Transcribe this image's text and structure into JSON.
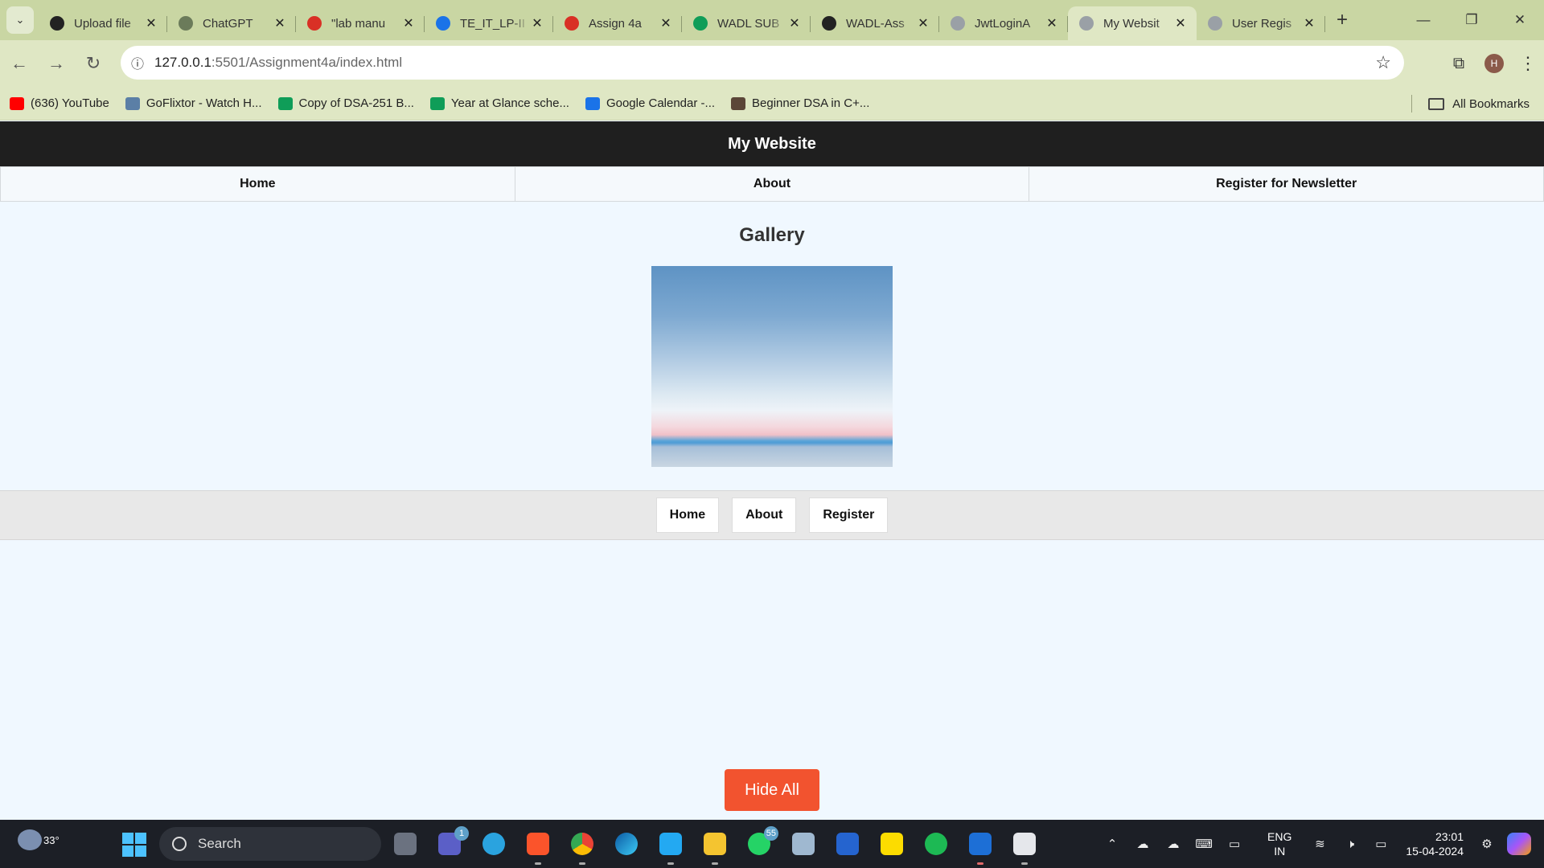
{
  "browser": {
    "tabs": [
      {
        "title": "Upload file",
        "favicon": "github-icon",
        "color": "#222222"
      },
      {
        "title": "ChatGPT",
        "favicon": "chatgpt-icon",
        "color": "#6b7b5a"
      },
      {
        "title": "\"lab manu",
        "favicon": "gmail-icon",
        "color": "#d93025"
      },
      {
        "title": "TE_IT_LP-II",
        "favicon": "drive-icon",
        "color": "#1a73e8"
      },
      {
        "title": "Assign 4a",
        "favicon": "gmail-icon",
        "color": "#d93025"
      },
      {
        "title": "WADL SUB",
        "favicon": "sheets-icon",
        "color": "#0f9d58"
      },
      {
        "title": "WADL-Ass",
        "favicon": "github-icon",
        "color": "#222222"
      },
      {
        "title": "JwtLoginA",
        "favicon": "globe-icon",
        "color": "#9aa0a6"
      },
      {
        "title": "My Websit",
        "favicon": "globe-icon",
        "color": "#9aa0a6",
        "active": true
      },
      {
        "title": "User Regis",
        "favicon": "globe-icon",
        "color": "#9aa0a6"
      }
    ],
    "url_host": "127.0.0.1",
    "url_rest": ":5501/Assignment4a/index.html",
    "profile_initial": "H",
    "bookmarks": [
      {
        "label": "(636) YouTube",
        "icon": "youtube-icon",
        "color": "#ff0000"
      },
      {
        "label": "GoFlixtor - Watch H...",
        "icon": "goflixtor-icon",
        "color": "#5b7fa6"
      },
      {
        "label": "Copy of DSA-251 B...",
        "icon": "sheets-icon",
        "color": "#0f9d58"
      },
      {
        "label": "Year at Glance sche...",
        "icon": "sheets-icon",
        "color": "#0f9d58"
      },
      {
        "label": "Google Calendar -...",
        "icon": "calendar-icon",
        "color": "#1a73e8"
      },
      {
        "label": "Beginner DSA in C+...",
        "icon": "codechef-icon",
        "color": "#5b4638"
      }
    ],
    "all_bookmarks": "All Bookmarks"
  },
  "site": {
    "header_title": "My Website",
    "nav": [
      "Home",
      "About",
      "Register for Newsletter"
    ],
    "gallery_title": "Gallery",
    "footer_nav": [
      "Home",
      "About",
      "Register"
    ],
    "hide_all": "Hide All"
  },
  "taskbar": {
    "temperature": "33°",
    "search_placeholder": "Search",
    "teams_badge": "1",
    "whatsapp_badge": "55",
    "lang_line1": "ENG",
    "lang_line2": "IN",
    "time": "23:01",
    "date": "15-04-2024"
  }
}
